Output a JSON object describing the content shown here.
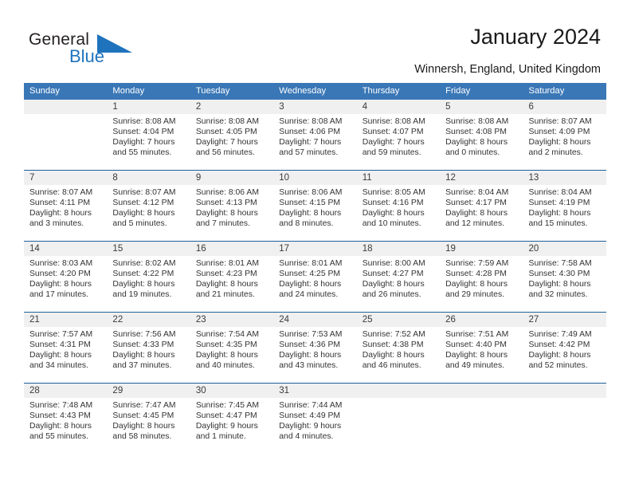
{
  "brand": {
    "name_part1": "General",
    "name_part2": "Blue",
    "triangle_icon": "triangle-icon",
    "colors": {
      "blue": "#1f73bd",
      "dark": "#231f20"
    }
  },
  "header": {
    "title": "January 2024",
    "subtitle": "Winnersh, England, United Kingdom"
  },
  "theme": {
    "header_bg": "#3a77b6",
    "header_text": "#ffffff",
    "date_band_bg": "#f0f0f0",
    "week_separator": "#1f6099",
    "cell_bg": "#ffffff",
    "body_text": "#333333"
  },
  "calendar": {
    "weekday_headers": [
      "Sunday",
      "Monday",
      "Tuesday",
      "Wednesday",
      "Thursday",
      "Friday",
      "Saturday"
    ],
    "weeks": [
      {
        "dates": [
          "",
          "1",
          "2",
          "3",
          "4",
          "5",
          "6"
        ],
        "cells": [
          {
            "lines": []
          },
          {
            "lines": [
              "Sunrise: 8:08 AM",
              "Sunset: 4:04 PM",
              "Daylight: 7 hours",
              "and 55 minutes."
            ]
          },
          {
            "lines": [
              "Sunrise: 8:08 AM",
              "Sunset: 4:05 PM",
              "Daylight: 7 hours",
              "and 56 minutes."
            ]
          },
          {
            "lines": [
              "Sunrise: 8:08 AM",
              "Sunset: 4:06 PM",
              "Daylight: 7 hours",
              "and 57 minutes."
            ]
          },
          {
            "lines": [
              "Sunrise: 8:08 AM",
              "Sunset: 4:07 PM",
              "Daylight: 7 hours",
              "and 59 minutes."
            ]
          },
          {
            "lines": [
              "Sunrise: 8:08 AM",
              "Sunset: 4:08 PM",
              "Daylight: 8 hours",
              "and 0 minutes."
            ]
          },
          {
            "lines": [
              "Sunrise: 8:07 AM",
              "Sunset: 4:09 PM",
              "Daylight: 8 hours",
              "and 2 minutes."
            ]
          }
        ]
      },
      {
        "dates": [
          "7",
          "8",
          "9",
          "10",
          "11",
          "12",
          "13"
        ],
        "cells": [
          {
            "lines": [
              "Sunrise: 8:07 AM",
              "Sunset: 4:11 PM",
              "Daylight: 8 hours",
              "and 3 minutes."
            ]
          },
          {
            "lines": [
              "Sunrise: 8:07 AM",
              "Sunset: 4:12 PM",
              "Daylight: 8 hours",
              "and 5 minutes."
            ]
          },
          {
            "lines": [
              "Sunrise: 8:06 AM",
              "Sunset: 4:13 PM",
              "Daylight: 8 hours",
              "and 7 minutes."
            ]
          },
          {
            "lines": [
              "Sunrise: 8:06 AM",
              "Sunset: 4:15 PM",
              "Daylight: 8 hours",
              "and 8 minutes."
            ]
          },
          {
            "lines": [
              "Sunrise: 8:05 AM",
              "Sunset: 4:16 PM",
              "Daylight: 8 hours",
              "and 10 minutes."
            ]
          },
          {
            "lines": [
              "Sunrise: 8:04 AM",
              "Sunset: 4:17 PM",
              "Daylight: 8 hours",
              "and 12 minutes."
            ]
          },
          {
            "lines": [
              "Sunrise: 8:04 AM",
              "Sunset: 4:19 PM",
              "Daylight: 8 hours",
              "and 15 minutes."
            ]
          }
        ]
      },
      {
        "dates": [
          "14",
          "15",
          "16",
          "17",
          "18",
          "19",
          "20"
        ],
        "cells": [
          {
            "lines": [
              "Sunrise: 8:03 AM",
              "Sunset: 4:20 PM",
              "Daylight: 8 hours",
              "and 17 minutes."
            ]
          },
          {
            "lines": [
              "Sunrise: 8:02 AM",
              "Sunset: 4:22 PM",
              "Daylight: 8 hours",
              "and 19 minutes."
            ]
          },
          {
            "lines": [
              "Sunrise: 8:01 AM",
              "Sunset: 4:23 PM",
              "Daylight: 8 hours",
              "and 21 minutes."
            ]
          },
          {
            "lines": [
              "Sunrise: 8:01 AM",
              "Sunset: 4:25 PM",
              "Daylight: 8 hours",
              "and 24 minutes."
            ]
          },
          {
            "lines": [
              "Sunrise: 8:00 AM",
              "Sunset: 4:27 PM",
              "Daylight: 8 hours",
              "and 26 minutes."
            ]
          },
          {
            "lines": [
              "Sunrise: 7:59 AM",
              "Sunset: 4:28 PM",
              "Daylight: 8 hours",
              "and 29 minutes."
            ]
          },
          {
            "lines": [
              "Sunrise: 7:58 AM",
              "Sunset: 4:30 PM",
              "Daylight: 8 hours",
              "and 32 minutes."
            ]
          }
        ]
      },
      {
        "dates": [
          "21",
          "22",
          "23",
          "24",
          "25",
          "26",
          "27"
        ],
        "cells": [
          {
            "lines": [
              "Sunrise: 7:57 AM",
              "Sunset: 4:31 PM",
              "Daylight: 8 hours",
              "and 34 minutes."
            ]
          },
          {
            "lines": [
              "Sunrise: 7:56 AM",
              "Sunset: 4:33 PM",
              "Daylight: 8 hours",
              "and 37 minutes."
            ]
          },
          {
            "lines": [
              "Sunrise: 7:54 AM",
              "Sunset: 4:35 PM",
              "Daylight: 8 hours",
              "and 40 minutes."
            ]
          },
          {
            "lines": [
              "Sunrise: 7:53 AM",
              "Sunset: 4:36 PM",
              "Daylight: 8 hours",
              "and 43 minutes."
            ]
          },
          {
            "lines": [
              "Sunrise: 7:52 AM",
              "Sunset: 4:38 PM",
              "Daylight: 8 hours",
              "and 46 minutes."
            ]
          },
          {
            "lines": [
              "Sunrise: 7:51 AM",
              "Sunset: 4:40 PM",
              "Daylight: 8 hours",
              "and 49 minutes."
            ]
          },
          {
            "lines": [
              "Sunrise: 7:49 AM",
              "Sunset: 4:42 PM",
              "Daylight: 8 hours",
              "and 52 minutes."
            ]
          }
        ]
      },
      {
        "dates": [
          "28",
          "29",
          "30",
          "31",
          "",
          "",
          ""
        ],
        "cells": [
          {
            "lines": [
              "Sunrise: 7:48 AM",
              "Sunset: 4:43 PM",
              "Daylight: 8 hours",
              "and 55 minutes."
            ]
          },
          {
            "lines": [
              "Sunrise: 7:47 AM",
              "Sunset: 4:45 PM",
              "Daylight: 8 hours",
              "and 58 minutes."
            ]
          },
          {
            "lines": [
              "Sunrise: 7:45 AM",
              "Sunset: 4:47 PM",
              "Daylight: 9 hours",
              "and 1 minute."
            ]
          },
          {
            "lines": [
              "Sunrise: 7:44 AM",
              "Sunset: 4:49 PM",
              "Daylight: 9 hours",
              "and 4 minutes."
            ]
          },
          {
            "lines": []
          },
          {
            "lines": []
          },
          {
            "lines": []
          }
        ]
      }
    ]
  }
}
